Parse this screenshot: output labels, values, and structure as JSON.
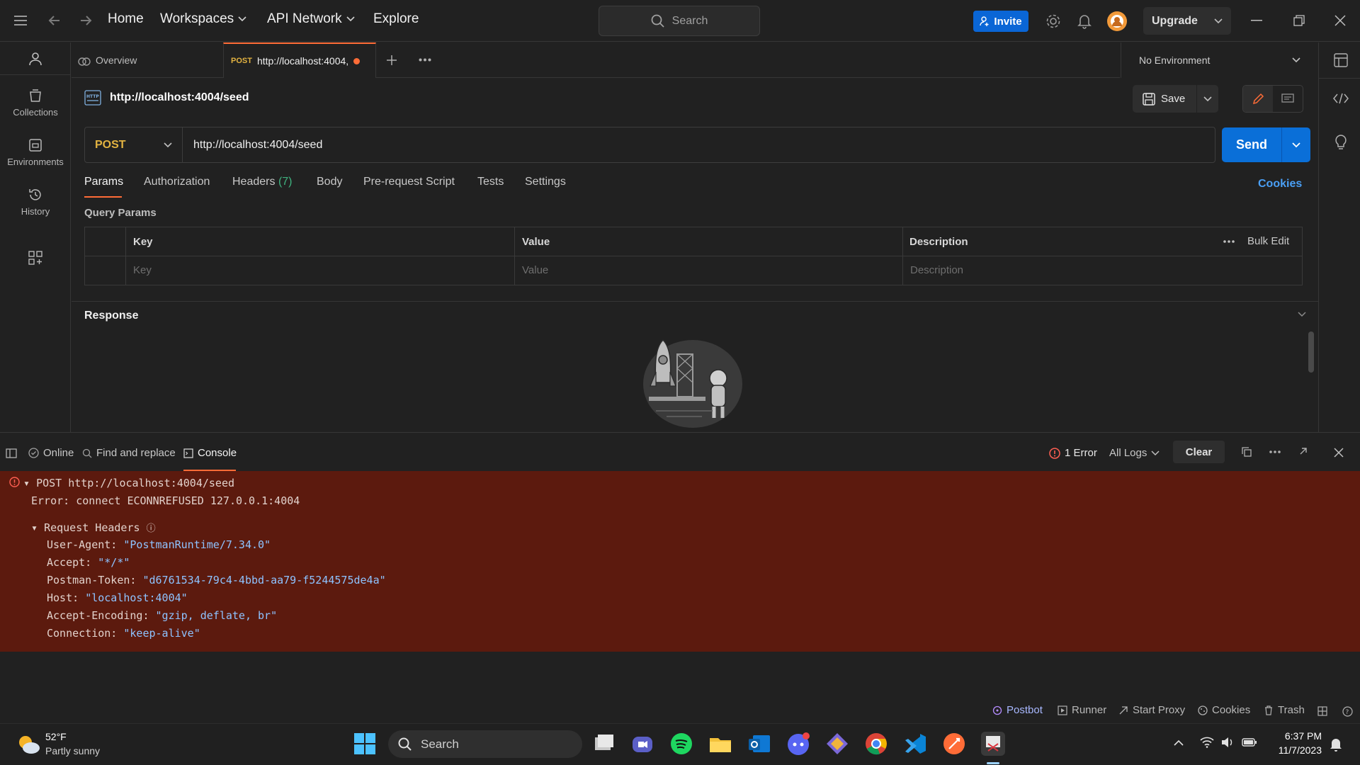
{
  "topbar": {
    "home": "Home",
    "workspaces": "Workspaces",
    "api_network": "API Network",
    "explore": "Explore",
    "search_placeholder": "Search",
    "invite": "Invite",
    "upgrade": "Upgrade"
  },
  "sidebar": {
    "items": [
      {
        "label": "Collections",
        "icon": "collections-icon"
      },
      {
        "label": "Environments",
        "icon": "environments-icon"
      },
      {
        "label": "History",
        "icon": "history-icon"
      }
    ]
  },
  "tabs": {
    "overview": "Overview",
    "active_method": "POST",
    "active_label": "http://localhost:4004,",
    "environment": "No Environment"
  },
  "request": {
    "title": "http://localhost:4004/seed",
    "save": "Save",
    "method": "POST",
    "url": "http://localhost:4004/seed",
    "send": "Send",
    "tabs": [
      "Params",
      "Authorization",
      "Headers",
      "Body",
      "Pre-request Script",
      "Tests",
      "Settings"
    ],
    "headers_count": "(7)",
    "cookies": "Cookies",
    "query_params_label": "Query Params",
    "columns": {
      "key": "Key",
      "value": "Value",
      "description": "Description"
    },
    "bulk_edit": "Bulk Edit",
    "placeholders": {
      "key": "Key",
      "value": "Value",
      "description": "Description"
    },
    "response_label": "Response"
  },
  "console_bar": {
    "online": "Online",
    "find_replace": "Find and replace",
    "console": "Console",
    "error_count": "1 Error",
    "all_logs": "All Logs",
    "clear": "Clear"
  },
  "console_log": {
    "request_line": "POST http://localhost:4004/seed",
    "error_line": "Error: connect ECONNREFUSED 127.0.0.1:4004",
    "headers_label": "Request Headers",
    "headers": [
      {
        "key": "User-Agent:",
        "value": "\"PostmanRuntime/7.34.0\""
      },
      {
        "key": "Accept:",
        "value": "\"*/*\""
      },
      {
        "key": "Postman-Token:",
        "value": "\"d6761534-79c4-4bbd-aa79-f5244575de4a\""
      },
      {
        "key": "Host:",
        "value": "\"localhost:4004\""
      },
      {
        "key": "Accept-Encoding:",
        "value": "\"gzip, deflate, br\""
      },
      {
        "key": "Connection:",
        "value": "\"keep-alive\""
      }
    ]
  },
  "status_bar": {
    "postbot": "Postbot",
    "runner": "Runner",
    "start_proxy": "Start Proxy",
    "cookies": "Cookies",
    "trash": "Trash"
  },
  "taskbar": {
    "weather_temp": "52°F",
    "weather_desc": "Partly sunny",
    "search": "Search",
    "time": "6:37 PM",
    "date": "11/7/2023"
  },
  "colors": {
    "accent_blue": "#0a6fd8",
    "method_post": "#e3b341",
    "active_tab_underline": "#ff6c37",
    "console_error_bg": "#5c1a0e",
    "error_red": "#ff5f52"
  }
}
